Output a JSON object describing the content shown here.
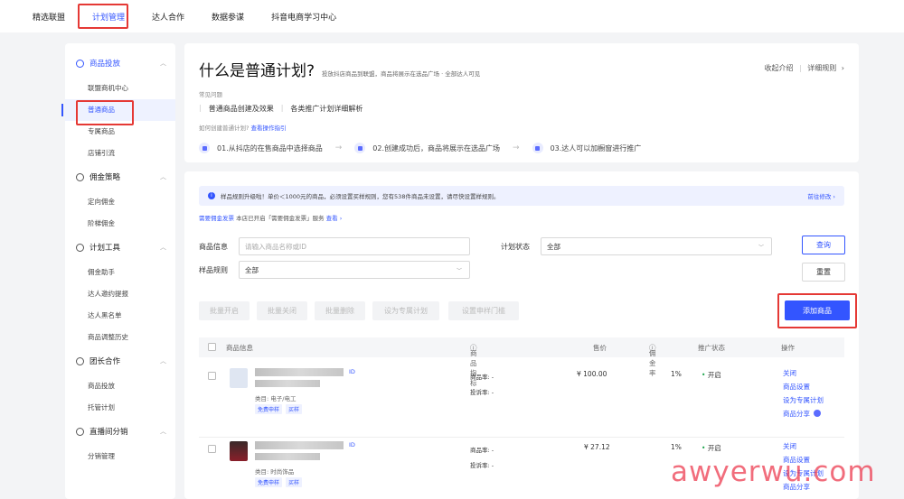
{
  "topnav": {
    "items": [
      "精选联盟",
      "计划管理",
      "达人合作",
      "数据参谋",
      "抖音电商学习中心"
    ]
  },
  "sidebar": {
    "groups": [
      {
        "title": "商品投放",
        "items": [
          "联盟商机中心",
          "普通商品",
          "专属商品",
          "店铺引流"
        ]
      },
      {
        "title": "佣金策略",
        "items": [
          "定向佣金",
          "阶梯佣金"
        ]
      },
      {
        "title": "计划工具",
        "items": [
          "佣金助手",
          "达人邀约提报",
          "达人黑名单",
          "商品调整历史"
        ]
      },
      {
        "title": "团长合作",
        "items": [
          "商品投放",
          "托管计划"
        ]
      },
      {
        "title": "直播间分销",
        "items": [
          "分销管理"
        ]
      }
    ]
  },
  "intro": {
    "title": "什么是普通计划?",
    "subtitle": "投放抖店商品到联盟，商品将展示在选品广场 · 全部达人可见",
    "collapse": "收起介绍",
    "detail": "详细规则",
    "faq_label": "常见问题",
    "faq_link1": "普通商品创建及效果",
    "faq_link2": "各类推广计划详细解析",
    "how_text": "如何创建普通计划?",
    "how_link": "查看操作指引",
    "steps": [
      "01.从抖店的在售商品中选择商品",
      "02.创建成功后，商品将展示在选品广场",
      "03.达人可以加橱窗进行推广"
    ]
  },
  "notice": {
    "text": "样品规则升级啦！单价＜1000元的商品，必须设置买样规则，您有538件商品未设置，请尽快设置样规则。",
    "action": "前往修改"
  },
  "subnote": {
    "badge": "需要佣金发票",
    "text": "本店已开启「需要佣金发票」服务",
    "link": "查看"
  },
  "filters": {
    "product_label": "商品信息",
    "product_placeholder": "请输入商品名称或ID",
    "status_label": "计划状态",
    "status_value": "全部",
    "sample_label": "样品规则",
    "sample_value": "全部",
    "query": "查询",
    "reset": "重置"
  },
  "batch": {
    "buttons": [
      "批量开启",
      "批量关闭",
      "批量删除",
      "设为专属计划",
      "设置申样门槛"
    ],
    "add": "添加商品"
  },
  "table": {
    "headers": [
      "商品信息",
      "商品指标",
      "售价",
      "佣金率",
      "推广状态",
      "操作"
    ],
    "rows": [
      {
        "category": "类目: 电子/电工",
        "tags": [
          "免费申样",
          "买样"
        ],
        "metric1": "商品率: -",
        "metric2": "投诉率: -",
        "price": "¥ 100.00",
        "rate": "1%",
        "status": "开启",
        "ops": [
          "关闭",
          "商品设置",
          "设为专属计划",
          "商品分享"
        ]
      },
      {
        "category": "类目: 时尚饰品",
        "tags": [
          "免费申样",
          "买样"
        ],
        "metric1": "商品率: -",
        "metric2": "投诉率: -",
        "price": "¥ 27.12",
        "rate": "1%",
        "status": "开启",
        "ops": [
          "关闭",
          "商品设置",
          "设为专属计划",
          "商品分享"
        ]
      }
    ]
  },
  "watermark": "awyerwu.com",
  "colors": {
    "accent": "#3355ff",
    "highlight": "#e53935"
  }
}
